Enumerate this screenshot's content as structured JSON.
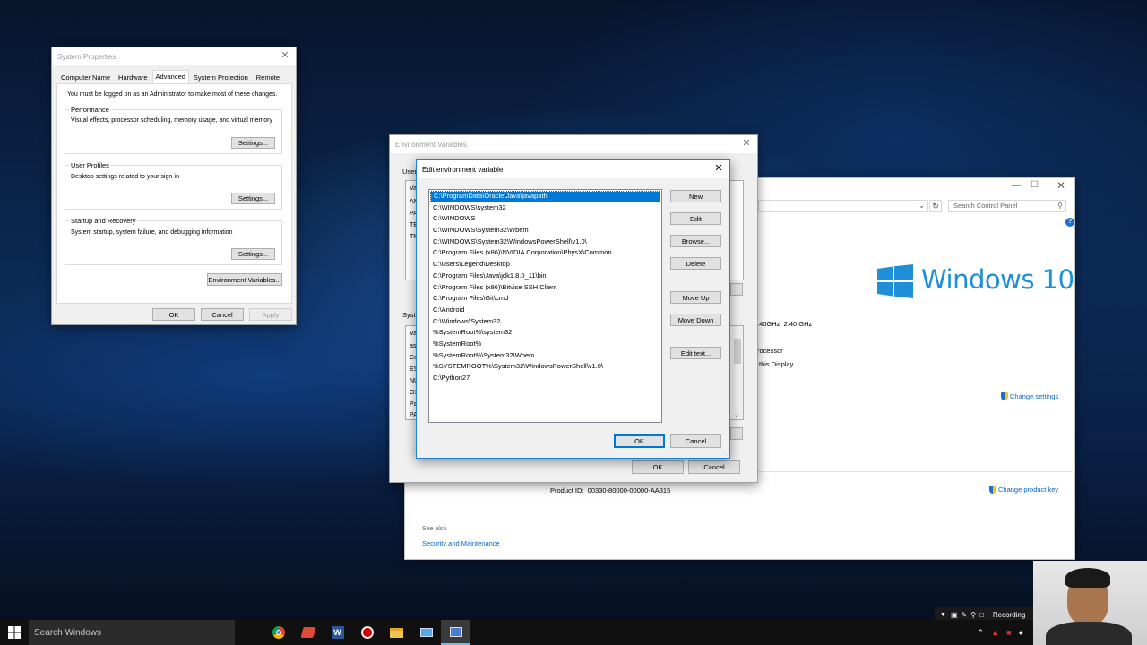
{
  "system_properties": {
    "title": "System Properties",
    "tabs": [
      {
        "label": "Computer Name",
        "active": false
      },
      {
        "label": "Hardware",
        "active": false
      },
      {
        "label": "Advanced",
        "active": true
      },
      {
        "label": "System Protection",
        "active": false
      },
      {
        "label": "Remote",
        "active": false
      }
    ],
    "admin_note": "You must be logged on as an Administrator to make most of these changes.",
    "performance": {
      "title": "Performance",
      "desc": "Visual effects, processor scheduling, memory usage, and virtual memory",
      "button": "Settings..."
    },
    "user_profiles": {
      "title": "User Profiles",
      "desc": "Desktop settings related to your sign-in",
      "button": "Settings..."
    },
    "startup_recovery": {
      "title": "Startup and Recovery",
      "desc": "System startup, system failure, and debugging information",
      "button": "Settings..."
    },
    "env_button": "Environment Variables...",
    "ok": "OK",
    "cancel": "Cancel",
    "apply": "Apply"
  },
  "control_panel": {
    "search_placeholder": "Search Control Panel",
    "windows_logo_text": "Windows 10",
    "ghz_text": ".40GHz  2.40 GHz",
    "processor_text": "rocessor",
    "display_text": "this Display",
    "change_settings": "Change settings",
    "product_id": "Product ID:  00330-80000-00000-AA315",
    "change_product_key": "Change product key",
    "see_also": "See also",
    "security_maintenance": "Security and Maintenance"
  },
  "environment_variables": {
    "title": "Environment Variables",
    "user_label": "User",
    "user_rows_col": [
      "Va",
      "AN",
      "PA",
      "TE",
      "TM"
    ],
    "system_label": "Syst",
    "system_rows_col": [
      "Va",
      "as",
      "Co",
      "ES",
      "NU",
      "OS",
      "Pa",
      "PA"
    ],
    "ok": "OK",
    "cancel": "Cancel"
  },
  "edit_env": {
    "title": "Edit environment variable",
    "entries": [
      "C:\\ProgramData\\Oracle\\Java\\javapath",
      "C:\\WINDOWS\\system32",
      "C:\\WINDOWS",
      "C:\\WINDOWS\\System32\\Wbem",
      "C:\\WINDOWS\\System32\\WindowsPowerShell\\v1.0\\",
      "C:\\Program Files (x86)\\NVIDIA Corporation\\PhysX\\Common",
      "C:\\Users\\Legend\\Desktop",
      "C:\\Program Files\\Java\\jdk1.8.0_11\\bin",
      "C:\\Program Files (x86)\\Bitvise SSH Client",
      "C:\\Program Files\\Git\\cmd",
      "C:\\Android",
      "C:\\Windows\\System32",
      "%SystemRoot%\\system32",
      "%SystemRoot%",
      "%SystemRoot%\\System32\\Wbem",
      "%SYSTEMROOT%\\System32\\WindowsPowerShell\\v1.0\\",
      "C:\\Python27"
    ],
    "selected_index": 0,
    "buttons": {
      "new": "New",
      "edit": "Edit",
      "browse": "Browse...",
      "delete": "Delete",
      "move_up": "Move Up",
      "move_down": "Move Down",
      "edit_text": "Edit text..."
    },
    "ok": "OK",
    "cancel": "Cancel"
  },
  "taskbar": {
    "search_text": "Search Windows",
    "apps": [
      "chrome-icon",
      "app-red-icon",
      "word-icon",
      "record-icon",
      "file-explorer-icon",
      "monitor-icon",
      "system-properties-icon"
    ],
    "recording_label": "Recording"
  },
  "colors": {
    "accent": "#0078d7",
    "link": "#0066cc",
    "windows_logo": "#1e8fd8"
  }
}
